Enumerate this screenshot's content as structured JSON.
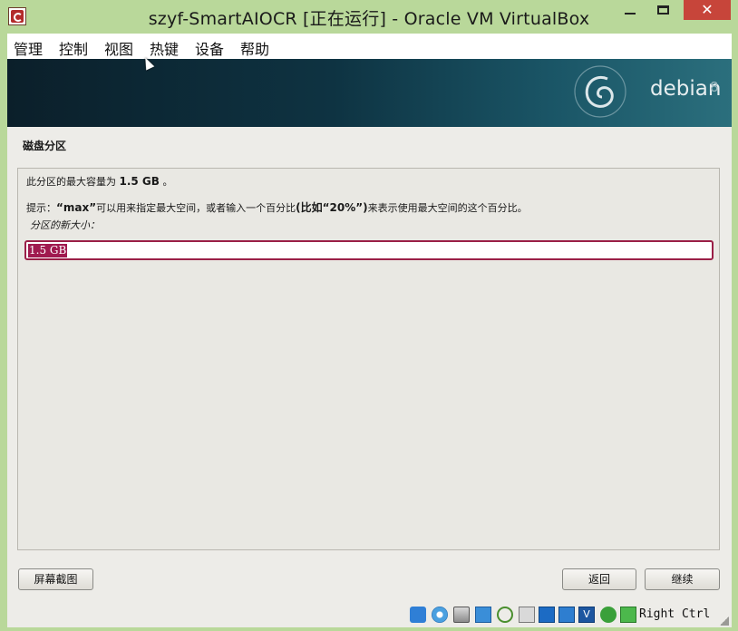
{
  "window": {
    "title": "szyf-SmartAIOCR [正在运行] - Oracle VM VirtualBox",
    "close_glyph": "✕"
  },
  "menubar": {
    "items": [
      "管理",
      "控制",
      "视图",
      "热键",
      "设备",
      "帮助"
    ]
  },
  "banner": {
    "brand": "debian",
    "version": "8"
  },
  "installer": {
    "section_title": "磁盘分区",
    "max_capacity_prefix": "此分区的最大容量为",
    "max_capacity_value": "1.5 GB",
    "max_capacity_suffix": "。",
    "hint_prefix": "提示：",
    "hint_keyword": "“max”",
    "hint_middle": "可以用来指定最大空间，或者输入一个百分比",
    "hint_example": "(比如“20%”)",
    "hint_suffix": "来表示使用最大空间的这个百分比。",
    "new_size_label": "分区的新大小：",
    "new_size_value": "1.5 GB"
  },
  "buttons": {
    "screenshot": "屏幕截图",
    "back": "返回",
    "continue": "继续"
  },
  "statusbar": {
    "host_key": "Right Ctrl",
    "icons": [
      "hdd-activity-icon",
      "optical-drive-icon",
      "audio-icon",
      "network-icon",
      "usb-icon",
      "shared-folders-icon",
      "display-icon",
      "video-capture-icon",
      "virtualization-icon",
      "mouse-integration-icon",
      "keyboard-capture-icon"
    ]
  },
  "colors": {
    "title_bar": "#b9d89a",
    "accent_selection": "#a01a4f",
    "close_button": "#c7453a"
  }
}
